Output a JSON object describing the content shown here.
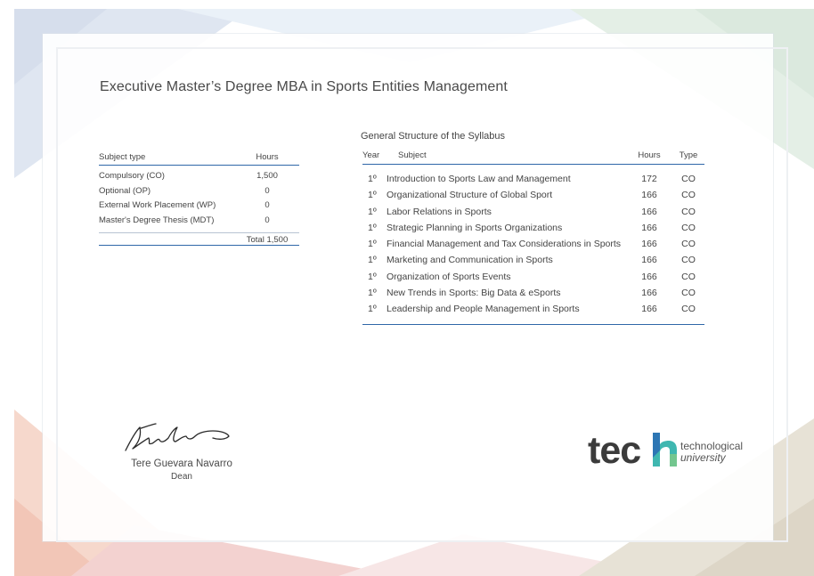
{
  "document": {
    "title": "Executive Master’s Degree MBA in Sports Entities Management"
  },
  "summary_table": {
    "headers": {
      "type": "Subject type",
      "hours": "Hours"
    },
    "rows": [
      {
        "type": "Compulsory (CO)",
        "hours": "1,500"
      },
      {
        "type": "Optional (OP)",
        "hours": "0"
      },
      {
        "type": "External Work Placement (WP)",
        "hours": "0"
      },
      {
        "type": "Master's Degree Thesis (MDT)",
        "hours": "0"
      }
    ],
    "total": "Total 1,500"
  },
  "syllabus": {
    "title": "General Structure of the Syllabus",
    "headers": {
      "year": "Year",
      "subject": "Subject",
      "hours": "Hours",
      "type": "Type"
    },
    "rows": [
      {
        "year": "1º",
        "subject": "Introduction to Sports Law and Management",
        "hours": "172",
        "type": "CO"
      },
      {
        "year": "1º",
        "subject": "Organizational Structure of Global Sport",
        "hours": "166",
        "type": "CO"
      },
      {
        "year": "1º",
        "subject": "Labor Relations in Sports",
        "hours": "166",
        "type": "CO"
      },
      {
        "year": "1º",
        "subject": "Strategic Planning in Sports Organizations",
        "hours": "166",
        "type": "CO"
      },
      {
        "year": "1º",
        "subject": "Financial Management and Tax Considerations in Sports",
        "hours": "166",
        "type": "CO"
      },
      {
        "year": "1º",
        "subject": "Marketing and Communication in Sports",
        "hours": "166",
        "type": "CO"
      },
      {
        "year": "1º",
        "subject": "Organization of Sports Events",
        "hours": "166",
        "type": "CO"
      },
      {
        "year": "1º",
        "subject": "New Trends in Sports: Big Data & eSports",
        "hours": "166",
        "type": "CO"
      },
      {
        "year": "1º",
        "subject": "Leadership and People Management in Sports",
        "hours": "166",
        "type": "CO"
      }
    ]
  },
  "signature": {
    "name": "Tere Guevara Navarro",
    "role": "Dean"
  },
  "logo": {
    "word": "tec",
    "line1": "technological",
    "line2": "university"
  },
  "colors": {
    "rule_blue": "#2f67a8",
    "logo_dark": "#3b3b3b",
    "logo_accent_teal": "#3fb7b0",
    "logo_accent_blue": "#2b6fb5"
  }
}
